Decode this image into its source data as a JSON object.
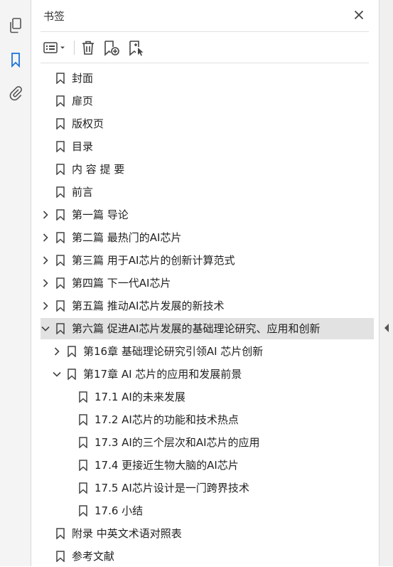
{
  "panel": {
    "title": "书签"
  },
  "leftbar": {
    "icons": [
      "pages-icon",
      "bookmark-icon",
      "attachment-icon"
    ]
  },
  "toolbar": {
    "buttons": [
      "options-menu-button",
      "delete-bookmark-button",
      "new-bookmark-button",
      "new-bookmark-from-structure-button"
    ]
  },
  "bookmarks": [
    {
      "label": "封面",
      "level": 0,
      "expander": "none"
    },
    {
      "label": "扉页",
      "level": 0,
      "expander": "none"
    },
    {
      "label": "版权页",
      "level": 0,
      "expander": "none"
    },
    {
      "label": "目录",
      "level": 0,
      "expander": "none"
    },
    {
      "label": "内 容 提 要",
      "level": 0,
      "expander": "none"
    },
    {
      "label": "前言",
      "level": 0,
      "expander": "none"
    },
    {
      "label": "第一篇 导论",
      "level": 0,
      "expander": "collapsed"
    },
    {
      "label": "第二篇 最热门的AI芯片",
      "level": 0,
      "expander": "collapsed"
    },
    {
      "label": "第三篇 用于AI芯片的创新计算范式",
      "level": 0,
      "expander": "collapsed"
    },
    {
      "label": "第四篇 下一代AI芯片",
      "level": 0,
      "expander": "collapsed"
    },
    {
      "label": "第五篇 推动AI芯片发展的新技术",
      "level": 0,
      "expander": "collapsed"
    },
    {
      "label": "第六篇 促进AI芯片发展的基础理论研究、应用和创新",
      "level": 0,
      "expander": "expanded",
      "selected": true
    },
    {
      "label": "第16章 基础理论研究引领AI 芯片创新",
      "level": 1,
      "expander": "collapsed"
    },
    {
      "label": "第17章 AI 芯片的应用和发展前景",
      "level": 1,
      "expander": "expanded"
    },
    {
      "label": "17.1 AI的未来发展",
      "level": 2,
      "expander": "none"
    },
    {
      "label": "17.2 AI芯片的功能和技术热点",
      "level": 2,
      "expander": "none"
    },
    {
      "label": "17.3 AI的三个层次和AI芯片的应用",
      "level": 2,
      "expander": "none"
    },
    {
      "label": "17.4 更接近生物大脑的AI芯片",
      "level": 2,
      "expander": "none"
    },
    {
      "label": "17.5 AI芯片设计是一门跨界技术",
      "level": 2,
      "expander": "none"
    },
    {
      "label": "17.6 小结",
      "level": 2,
      "expander": "none"
    },
    {
      "label": "附录 中英文术语对照表",
      "level": 0,
      "expander": "none"
    },
    {
      "label": "参考文献",
      "level": 0,
      "expander": "none"
    }
  ]
}
